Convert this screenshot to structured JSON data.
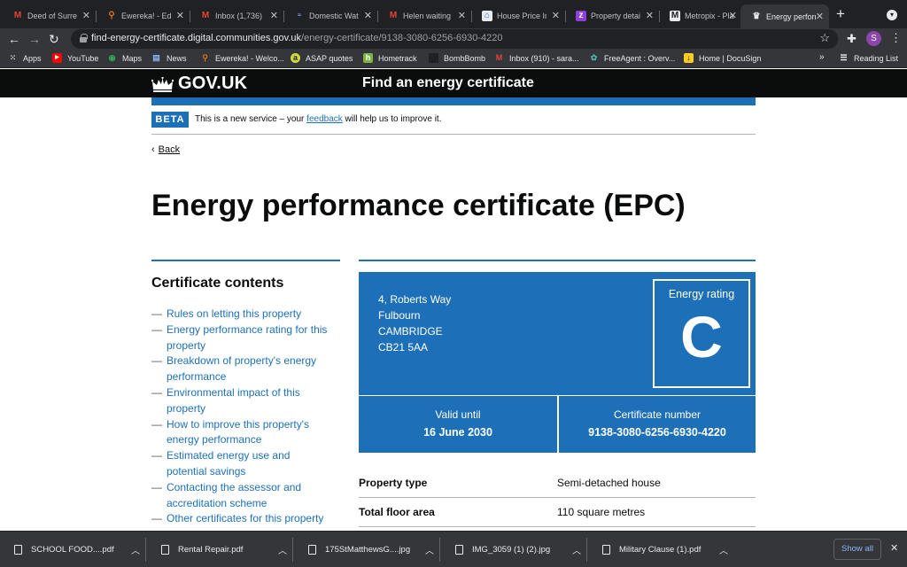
{
  "browser": {
    "tabs": [
      {
        "label": "Deed of Surrender",
        "icon": "gmail-icon",
        "active": false
      },
      {
        "label": "Ewereka! - Edit",
        "icon": "ewereka-icon",
        "active": false
      },
      {
        "label": "Inbox (1,736)",
        "icon": "gmail-icon",
        "active": false
      },
      {
        "label": "Domestic Water",
        "icon": "water-icon",
        "active": false
      },
      {
        "label": "Helen waiting",
        "icon": "gmail-icon",
        "active": false
      },
      {
        "label": "House Price Index",
        "icon": "house-icon",
        "active": false
      },
      {
        "label": "Property details",
        "icon": "zoopla-icon",
        "active": false
      },
      {
        "label": "Metropix - Plan",
        "icon": "metropix-icon",
        "active": false
      },
      {
        "label": "Energy performance",
        "icon": "govuk-crown-icon",
        "active": true
      }
    ],
    "url_host": "find-energy-certificate.digital.communities.gov.uk",
    "url_path": "/energy-certificate/9138-3080-6256-6930-4220",
    "profile_initial": "S",
    "bookmarks": [
      {
        "label": "Apps",
        "icon": "apps-grid-icon"
      },
      {
        "label": "YouTube",
        "icon": "youtube-icon"
      },
      {
        "label": "Maps",
        "icon": "maps-icon"
      },
      {
        "label": "News",
        "icon": "news-icon"
      },
      {
        "label": "Ewereka! - Welco...",
        "icon": "ewereka-icon"
      },
      {
        "label": "ASAP quotes",
        "icon": "asap-icon"
      },
      {
        "label": "Hometrack",
        "icon": "hometrack-icon"
      },
      {
        "label": "BombBomb",
        "icon": "bombbomb-icon"
      },
      {
        "label": "Inbox (910) - sara...",
        "icon": "gmail-icon"
      },
      {
        "label": "FreeAgent : Overv...",
        "icon": "freeagent-icon"
      },
      {
        "label": "Home | DocuSign",
        "icon": "docusign-icon"
      }
    ],
    "bookmarks_overflow": "»",
    "reading_list": "Reading List"
  },
  "govuk": {
    "logo_text": "GOV.UK",
    "service_name": "Find an energy certificate",
    "phase_tag": "BETA",
    "phase_text_before": "This is a new service – your ",
    "phase_link": "feedback",
    "phase_text_after": " will help us to improve it.",
    "back_link": "Back",
    "page_title": "Energy performance certificate (EPC)"
  },
  "contents": {
    "heading": "Certificate contents",
    "items": [
      "Rules on letting this property",
      "Energy performance rating for this property",
      "Breakdown of property's energy performance",
      "Environmental impact of this property",
      "How to improve this property's energy performance",
      "Estimated energy use and potential savings",
      "Contacting the assessor and accreditation scheme",
      "Other certificates for this property"
    ]
  },
  "certificate": {
    "address_line_1": "4, Roberts Way",
    "address_line_2": "Fulbourn",
    "address_line_3": "CAMBRIDGE",
    "postcode": "CB21 5AA",
    "rating_label": "Energy rating",
    "rating": "C",
    "valid_until_label": "Valid until",
    "valid_until": "16 June 2030",
    "cert_number_label": "Certificate number",
    "cert_number": "9138-3080-6256-6930-4220",
    "summary": [
      {
        "key": "Property type",
        "value": "Semi-detached house"
      },
      {
        "key": "Total floor area",
        "value": "110 square metres"
      }
    ]
  },
  "downloads": {
    "items": [
      "SCHOOL FOOD....pdf",
      "Rental Repair.pdf",
      "175StMatthewsG....jpg",
      "IMG_3059 (1) (2).jpg",
      "Military Clause  (1).pdf"
    ],
    "show_all": "Show all"
  },
  "colors": {
    "govuk_blue": "#1d70b8",
    "govuk_black": "#0b0c0c",
    "chrome_dark": "#202124",
    "chrome_toolbar": "#35363a"
  }
}
